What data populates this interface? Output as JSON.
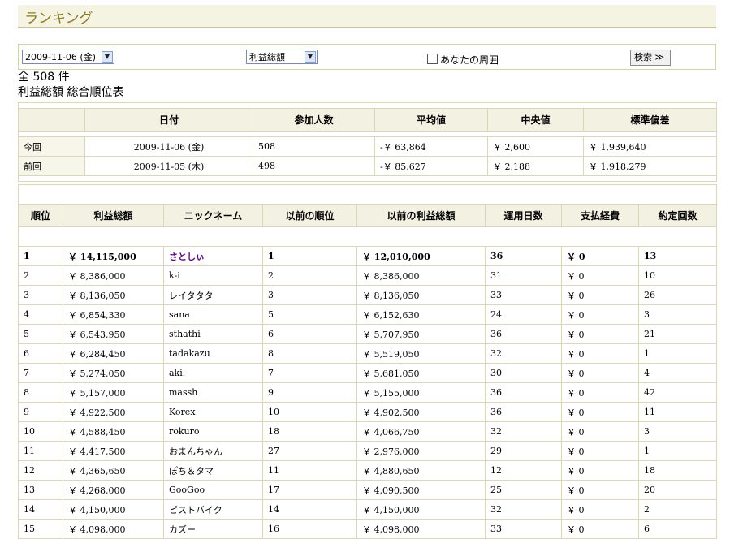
{
  "page": {
    "title": "ランキング"
  },
  "search": {
    "date_value": "2009-11-06 (金)",
    "metric_value": "利益総額",
    "neighbors_label": "あなたの周囲",
    "search_button": "検索 ≫"
  },
  "summary": {
    "total": "全 508 件",
    "table_title": "利益総額 総合順位表"
  },
  "stats": {
    "headers": [
      "日付",
      "参加人数",
      "平均値",
      "中央値",
      "標準偏差"
    ],
    "rows": [
      {
        "label": "今回",
        "date": "2009-11-06 (金)",
        "participants": "508",
        "mean": "-￥ 63,864",
        "median": "￥ 2,600",
        "stdev": "￥ 1,939,640"
      },
      {
        "label": "前回",
        "date": "2009-11-05 (木)",
        "participants": "498",
        "mean": "-￥ 85,627",
        "median": "￥ 2,188",
        "stdev": "￥ 1,918,279"
      }
    ]
  },
  "ranking": {
    "headers": [
      "順位",
      "利益総額",
      "ニックネーム",
      "以前の順位",
      "以前の利益総額",
      "運用日数",
      "支払経費",
      "約定回数"
    ],
    "rows": [
      [
        "1",
        "￥ 14,115,000",
        "さとしぃ",
        "1",
        "￥ 12,010,000",
        "36",
        "￥ 0",
        "13"
      ],
      [
        "2",
        "￥ 8,386,000",
        "k-i",
        "2",
        "￥ 8,386,000",
        "31",
        "￥ 0",
        "10"
      ],
      [
        "3",
        "￥ 8,136,050",
        "レイタタタ",
        "3",
        "￥ 8,136,050",
        "33",
        "￥ 0",
        "26"
      ],
      [
        "4",
        "￥ 6,854,330",
        "sana",
        "5",
        "￥ 6,152,630",
        "24",
        "￥ 0",
        "3"
      ],
      [
        "5",
        "￥ 6,543,950",
        "sthathi",
        "6",
        "￥ 5,707,950",
        "36",
        "￥ 0",
        "21"
      ],
      [
        "6",
        "￥ 6,284,450",
        "tadakazu",
        "8",
        "￥ 5,519,050",
        "32",
        "￥ 0",
        "1"
      ],
      [
        "7",
        "￥ 5,274,050",
        "aki.",
        "7",
        "￥ 5,681,050",
        "30",
        "￥ 0",
        "4"
      ],
      [
        "8",
        "￥ 5,157,000",
        "massh",
        "9",
        "￥ 5,155,000",
        "36",
        "￥ 0",
        "42"
      ],
      [
        "9",
        "￥ 4,922,500",
        "Korex",
        "10",
        "￥ 4,902,500",
        "36",
        "￥ 0",
        "11"
      ],
      [
        "10",
        "￥ 4,588,450",
        "rokuro",
        "18",
        "￥ 4,066,750",
        "32",
        "￥ 0",
        "3"
      ],
      [
        "11",
        "￥ 4,417,500",
        "おまんちゃん",
        "27",
        "￥ 2,976,000",
        "29",
        "￥ 0",
        "1"
      ],
      [
        "12",
        "￥ 4,365,650",
        "ぽち＆タマ",
        "11",
        "￥ 4,880,650",
        "12",
        "￥ 0",
        "18"
      ],
      [
        "13",
        "￥ 4,268,000",
        "GooGoo",
        "17",
        "￥ 4,090,500",
        "25",
        "￥ 0",
        "20"
      ],
      [
        "14",
        "￥ 4,150,000",
        "ピストバイク",
        "14",
        "￥ 4,150,000",
        "32",
        "￥ 0",
        "2"
      ],
      [
        "15",
        "￥ 4,098,000",
        "カズー",
        "16",
        "￥ 4,098,000",
        "33",
        "￥ 0",
        "6"
      ]
    ]
  }
}
